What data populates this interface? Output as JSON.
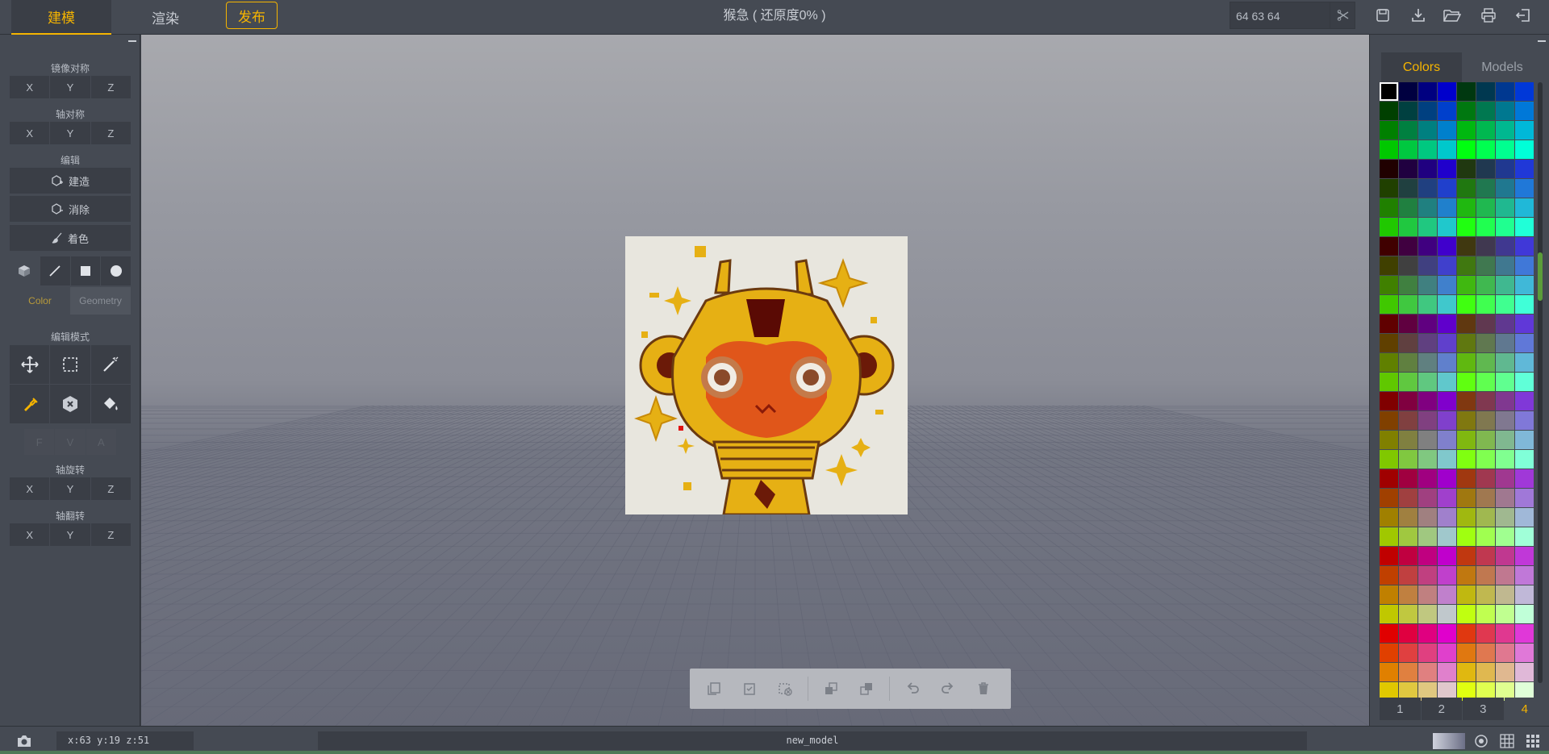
{
  "header": {
    "tab_model": "建模",
    "tab_render": "渲染",
    "publish": "发布",
    "doc_title": "猴急 ( 还原度0% )",
    "size_value": "64  63  64"
  },
  "left_panel": {
    "mirror_title": "镜像对称",
    "axis_sym_title": "轴对称",
    "edit_title": "编辑",
    "build_label": "建造",
    "erase_label": "消除",
    "paint_label": "着色",
    "mode_color": "Color",
    "mode_geometry": "Geometry",
    "edit_mode_title": "编辑模式",
    "rotate_title": "轴旋转",
    "flip_title": "轴翻转",
    "axes": [
      "X",
      "Y",
      "Z"
    ],
    "fva": [
      "F",
      "V",
      "A"
    ]
  },
  "right_panel": {
    "tab_colors": "Colors",
    "tab_models": "Models",
    "pages": [
      "1",
      "2",
      "3",
      "4"
    ],
    "active_page": "4"
  },
  "status": {
    "coords": "x:63  y:19  z:51",
    "model_name": "new_model"
  },
  "colors": {
    "accent": "#f5b400",
    "panel_bg": "#454a53",
    "button_bg": "#3a3e46"
  },
  "icons": [
    "save-icon",
    "download-icon",
    "folder-open-icon",
    "print-icon",
    "exit-icon",
    "camera-icon",
    "target-icon",
    "grid-icon",
    "grid-dense-icon"
  ]
}
